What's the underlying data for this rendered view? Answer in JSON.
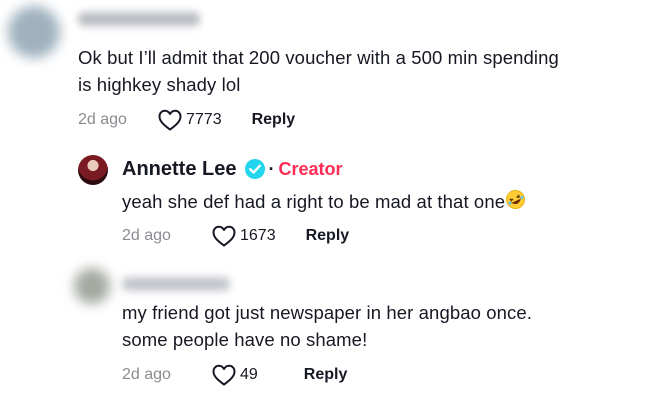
{
  "comments": [
    {
      "author": "",
      "text_lines": [
        "Ok but I’ll admit that 200 voucher with a 500 min spending",
        "is highkey shady lol"
      ],
      "date": "2d ago",
      "likes": "7773",
      "reply_label": "Reply"
    },
    {
      "author": "Annette Lee",
      "badge": "Creator",
      "separator": "·",
      "text": "yeah she def had a right to be mad at that one",
      "emoji": "rolling-on-floor-laughing",
      "date": "2d ago",
      "likes": "1673",
      "reply_label": "Reply"
    },
    {
      "author": "",
      "text_lines": [
        "my friend got just newspaper in her angbao once.",
        "some people have no shame!"
      ],
      "date": "2d ago",
      "likes": "49",
      "reply_label": "Reply"
    }
  ],
  "colors": {
    "text": "#161823",
    "muted": "#8a8b91",
    "creator": "#fe2c55",
    "verified": "#20d5ec"
  }
}
